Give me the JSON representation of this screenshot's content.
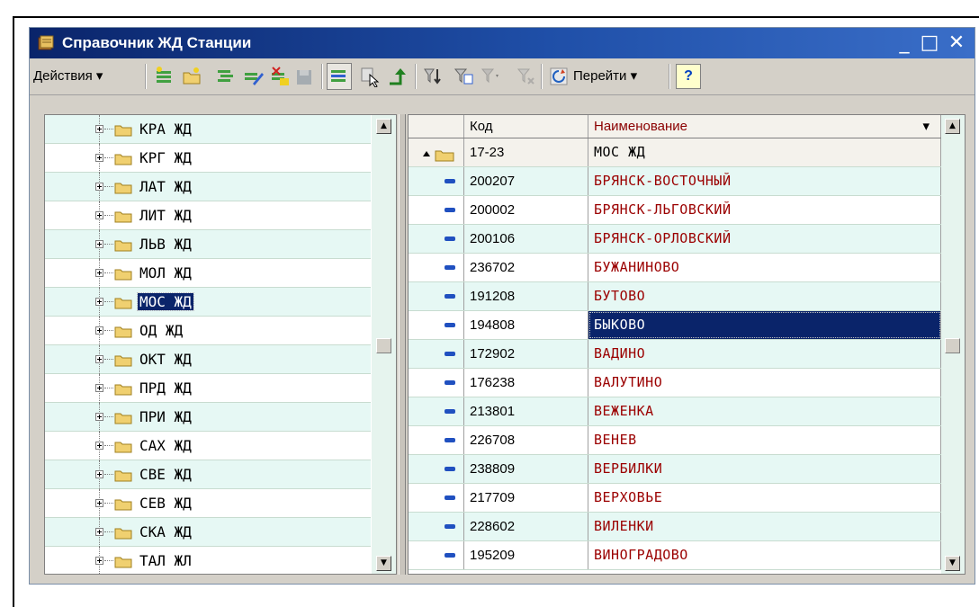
{
  "window": {
    "title": "Справочник ЖД Станции",
    "minimize": "_",
    "maximize": "□",
    "close": "✕"
  },
  "toolbar": {
    "actions_label": "Действия ▾",
    "goto_label": "Перейти ▾",
    "help_label": "?"
  },
  "tree": {
    "items": [
      {
        "label": "КРА ЖД"
      },
      {
        "label": "КРГ ЖД"
      },
      {
        "label": "ЛАТ ЖД"
      },
      {
        "label": "ЛИТ ЖД"
      },
      {
        "label": "ЛЬВ ЖД"
      },
      {
        "label": "МОЛ ЖД"
      },
      {
        "label": "МОС ЖД",
        "selected": true
      },
      {
        "label": "ОД ЖД"
      },
      {
        "label": "ОКТ ЖД"
      },
      {
        "label": "ПРД ЖД"
      },
      {
        "label": "ПРИ ЖД"
      },
      {
        "label": "САХ ЖД"
      },
      {
        "label": "СВЕ ЖД"
      },
      {
        "label": "СЕВ ЖД"
      },
      {
        "label": "СКА ЖД"
      },
      {
        "label": "ТАЛ ЖЛ"
      }
    ]
  },
  "table": {
    "columns": {
      "code": "Код",
      "name": "Наименование",
      "sort_marker": "▾"
    },
    "parent_row": {
      "code": "17-23",
      "name": "МОС ЖД"
    },
    "rows": [
      {
        "code": "200207",
        "name": "БРЯНСК-ВОСТОЧНЫЙ"
      },
      {
        "code": "200002",
        "name": "БРЯНСК-ЛЬГОВСКИЙ"
      },
      {
        "code": "200106",
        "name": "БРЯНСК-ОРЛОВСКИЙ"
      },
      {
        "code": "236702",
        "name": "БУЖАНИНОВО"
      },
      {
        "code": "191208",
        "name": "БУТОВО"
      },
      {
        "code": "194808",
        "name": "БЫКОВО",
        "selected": true
      },
      {
        "code": "172902",
        "name": "ВАДИНО"
      },
      {
        "code": "176238",
        "name": "ВАЛУТИНО"
      },
      {
        "code": "213801",
        "name": "ВЕЖЕНКА"
      },
      {
        "code": "226708",
        "name": "ВЕНЕВ"
      },
      {
        "code": "238809",
        "name": "ВЕРБИЛКИ"
      },
      {
        "code": "217709",
        "name": "ВЕРХОВЬЕ"
      },
      {
        "code": "228602",
        "name": "ВИЛЕНКИ"
      },
      {
        "code": "195209",
        "name": "ВИНОГРАДОВО"
      }
    ]
  },
  "colors": {
    "title_bar": "#0a246a",
    "row_tint": "#e6f8f4",
    "name_text": "#9b0000",
    "selection": "#0a246a"
  }
}
